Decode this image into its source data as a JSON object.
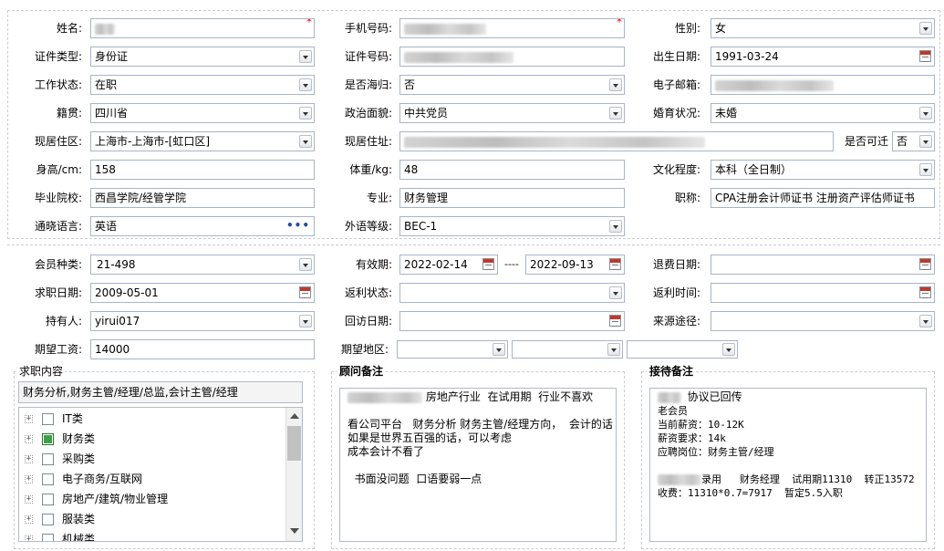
{
  "basic": {
    "name": {
      "label": "姓名:",
      "value": "",
      "required": "*"
    },
    "phone": {
      "label": "手机号码:",
      "value": "",
      "required": "*"
    },
    "gender": {
      "label": "性别:",
      "value": "女"
    },
    "id_type": {
      "label": "证件类型:",
      "value": "身份证"
    },
    "id_number": {
      "label": "证件号码:",
      "value": ""
    },
    "birth_date": {
      "label": "出生日期:",
      "value": "1991-03-24"
    },
    "work_status": {
      "label": "工作状态:",
      "value": "在职"
    },
    "overseas_return": {
      "label": "是否海归:",
      "value": "否"
    },
    "email": {
      "label": "电子邮箱:",
      "value": ""
    },
    "native_place": {
      "label": "籍贯:",
      "value": "四川省"
    },
    "political_status": {
      "label": "政治面貌:",
      "value": "中共党员"
    },
    "marital_status": {
      "label": "婚育状况:",
      "value": "未婚"
    },
    "residence": {
      "label": "现居住区:",
      "value": "上海市-上海市-[虹口区]"
    },
    "address": {
      "label": "现居住址:",
      "value": ""
    },
    "relocatable": {
      "label": "是否可迁",
      "value": "否"
    },
    "height": {
      "label": "身高/cm:",
      "value": "158"
    },
    "weight": {
      "label": "体重/kg:",
      "value": "48"
    },
    "education": {
      "label": "文化程度:",
      "value": "本科（全日制）"
    },
    "school": {
      "label": "毕业院校:",
      "value": "西昌学院/经管学院"
    },
    "major": {
      "label": "专业:",
      "value": "财务管理"
    },
    "title": {
      "label": "职称:",
      "value": "CPA注册会计师证书 注册资产评估师证书"
    },
    "language": {
      "label": "通晓语言:",
      "value": "英语",
      "more": "•••"
    },
    "language_level": {
      "label": "外语等级:",
      "value": "BEC-1"
    }
  },
  "member": {
    "type": {
      "label": "会员种类:",
      "value": "21-498"
    },
    "validity": {
      "label": "有效期:",
      "from": "2022-02-14",
      "sep": "----",
      "to": "2022-09-13"
    },
    "refund_date": {
      "label": "退费日期:",
      "value": ""
    },
    "job_date": {
      "label": "求职日期:",
      "value": "2009-05-01"
    },
    "rebate_status": {
      "label": "返利状态:",
      "value": ""
    },
    "rebate_time": {
      "label": "返利时间:",
      "value": ""
    },
    "holder": {
      "label": "持有人:",
      "value": "yirui017"
    },
    "visit_date": {
      "label": "回访日期:",
      "value": ""
    },
    "source": {
      "label": "来源途径:",
      "value": ""
    },
    "salary": {
      "label": "期望工资:",
      "value": "14000"
    },
    "region": {
      "label": "期望地区:",
      "value1": "",
      "value2": "",
      "value3": ""
    }
  },
  "job_content": {
    "title": "求职内容",
    "summary": "财务分析,财务主管/经理/总监,会计主管/经理",
    "tree": [
      {
        "label": "IT类",
        "checked": false
      },
      {
        "label": "财务类",
        "checked": true
      },
      {
        "label": "采购类",
        "checked": false
      },
      {
        "label": "电子商务/互联网",
        "checked": false
      },
      {
        "label": "房地产/建筑/物业管理",
        "checked": false
      },
      {
        "label": "服装类",
        "checked": false
      },
      {
        "label": "机械类",
        "checked": false
      }
    ],
    "expand": "+"
  },
  "advisor_notes": {
    "title": "顾问备注",
    "lines": [
      "房地产行业  在试用期  行业不喜欢",
      "",
      "看公司平台   财务分析 财务主管/经理方向，  会计的话",
      "如果是世界五百强的话，可以考虑",
      "成本会计不看了",
      "",
      "  书面没问题  口语要弱一点"
    ]
  },
  "reception_notes": {
    "title": "接待备注",
    "lines": [
      "协议已回传",
      "老会员",
      "当前薪资：10-12K",
      "薪资要求：14k",
      "应聘岗位：财务主管/经理",
      "",
      "录用   财务经理  试用期11310  转正13572",
      "收费：11310*0.7=7917  暂定5.5入职"
    ]
  },
  "colors": {
    "border": "#a9b4c4",
    "required": "#ee0000",
    "checked": "#3aa14a"
  }
}
